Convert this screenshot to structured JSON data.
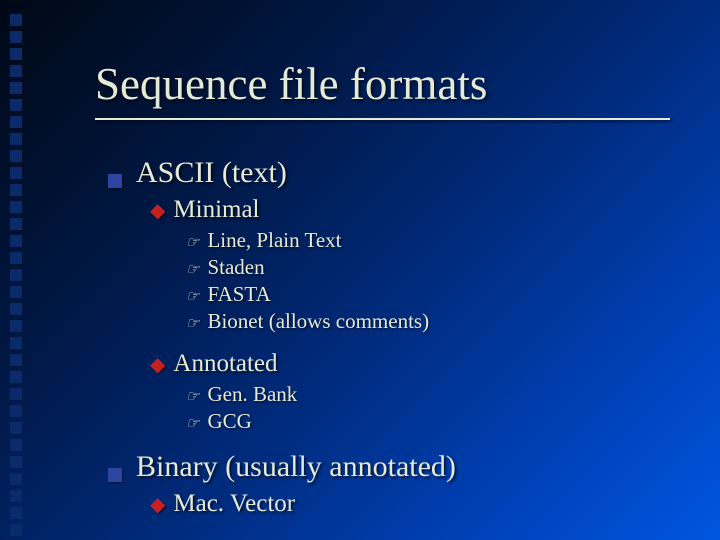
{
  "title": "Sequence file formats",
  "outline": [
    {
      "label": "ASCII (text)",
      "children": [
        {
          "label": "Minimal",
          "children": [
            {
              "label": "Line, Plain Text"
            },
            {
              "label": "Staden"
            },
            {
              "label": "FASTA"
            },
            {
              "label": "Bionet (allows comments)"
            }
          ]
        },
        {
          "label": "Annotated",
          "children": [
            {
              "label": "Gen. Bank"
            },
            {
              "label": "GCG"
            }
          ]
        }
      ]
    },
    {
      "label": "Binary (usually annotated)",
      "children": [
        {
          "label": "Mac. Vector",
          "children": []
        }
      ]
    }
  ]
}
